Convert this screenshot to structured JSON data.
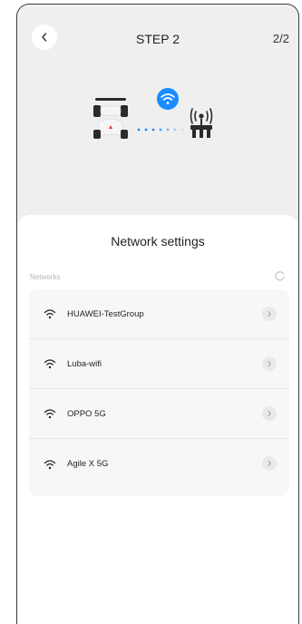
{
  "header": {
    "title": "STEP 2",
    "step_count": "2/2"
  },
  "sheet": {
    "title": "Network settings",
    "section_label": "Networks",
    "networks": [
      {
        "name": "HUAWEI-TestGroup"
      },
      {
        "name": "Luba-wifi"
      },
      {
        "name": "OPPO 5G"
      },
      {
        "name": "Agile X 5G"
      }
    ]
  },
  "colors": {
    "accent": "#1a8cff",
    "mower_body": "#f5f5f5",
    "mower_dark": "#2b2b2b",
    "mower_red": "#e53935"
  },
  "icons": {
    "back": "chevron-left-icon",
    "wifi_badge": "wifi-icon",
    "mower": "mower-icon",
    "station": "rtk-station-icon",
    "refresh": "refresh-icon",
    "row_wifi": "wifi-icon",
    "row_chevron": "chevron-right-icon"
  }
}
